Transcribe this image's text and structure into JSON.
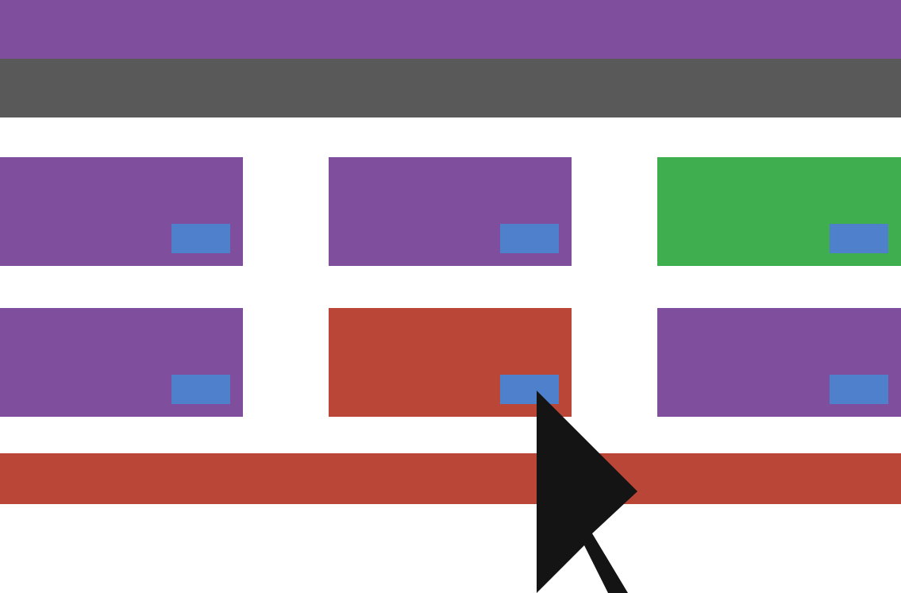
{
  "colors": {
    "header": "#7f4e9d",
    "nav": "#595959",
    "footer": "#ba4637",
    "action": "#4f80cb",
    "cursor": "#141414"
  },
  "header": {
    "label": ""
  },
  "nav": {
    "label": ""
  },
  "footer": {
    "label": ""
  },
  "cards": [
    {
      "color": "#7f4e9d",
      "state": "default",
      "action_label": ""
    },
    {
      "color": "#7f4e9d",
      "state": "default",
      "action_label": ""
    },
    {
      "color": "#3fae4f",
      "state": "success",
      "action_label": ""
    },
    {
      "color": "#7f4e9d",
      "state": "default",
      "action_label": ""
    },
    {
      "color": "#ba4637",
      "state": "error",
      "action_label": ""
    },
    {
      "color": "#7f4e9d",
      "state": "default",
      "action_label": ""
    }
  ],
  "cursor": {
    "icon": "pointer-arrow-icon"
  }
}
